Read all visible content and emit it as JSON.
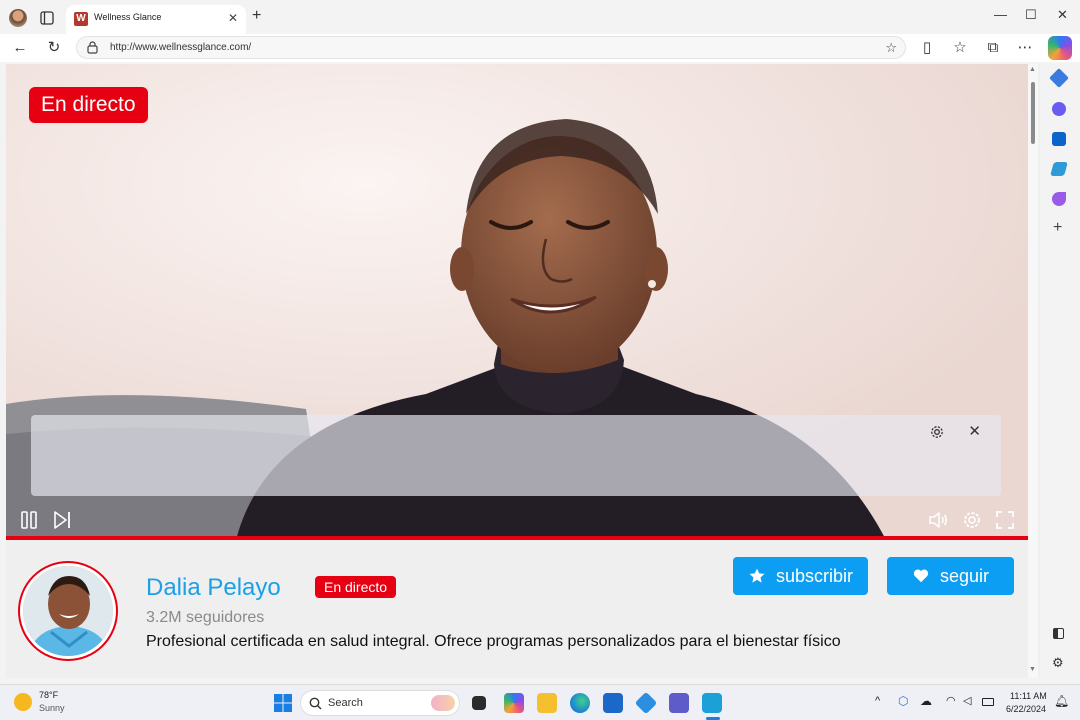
{
  "browser": {
    "tab_title": "Wellness Glance",
    "tab_favicon_letter": "W",
    "url": "http://www.wellnessglance.com/",
    "accent": "#e60012"
  },
  "video": {
    "live_badge": "En directo",
    "progress_percent": 100
  },
  "profile": {
    "name": "Dalia Pelayo",
    "live_badge": "En directo",
    "followers": "3.2M seguidores",
    "bio": "Profesional certificada en salud integral. Ofrece programas personalizados para el bienestar físico",
    "subscribe_label": "subscribir",
    "follow_label": "seguir",
    "name_color": "#1aa0e6",
    "button_color": "#0b9ef2"
  },
  "taskbar": {
    "weather_temp": "78°F",
    "weather_cond": "Sunny",
    "search_placeholder": "Search",
    "time": "11:11 AM",
    "date": "6/22/2024"
  }
}
